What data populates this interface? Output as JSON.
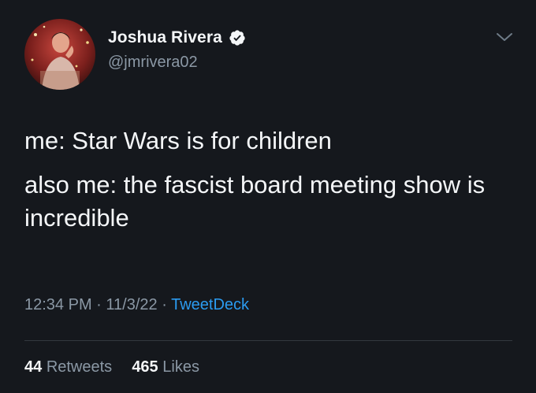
{
  "author": {
    "display_name": "Joshua Rivera",
    "handle": "@jmrivera02",
    "verified": true
  },
  "tweet": {
    "lines": [
      "me: Star Wars is for children",
      "also me: the fascist board meeting show is incredible"
    ]
  },
  "meta": {
    "time": "12:34 PM",
    "separator": "·",
    "date": "11/3/22",
    "source": "TweetDeck"
  },
  "stats": {
    "retweets_count": "44",
    "retweets_label": "Retweets",
    "likes_count": "465",
    "likes_label": "Likes"
  },
  "icons": {
    "verified": "verified-badge-icon",
    "menu": "chevron-down-icon"
  },
  "colors": {
    "background": "#15181d",
    "text_primary": "#f4f6f8",
    "text_secondary": "#8b98a5",
    "link": "#2b9bf0"
  }
}
